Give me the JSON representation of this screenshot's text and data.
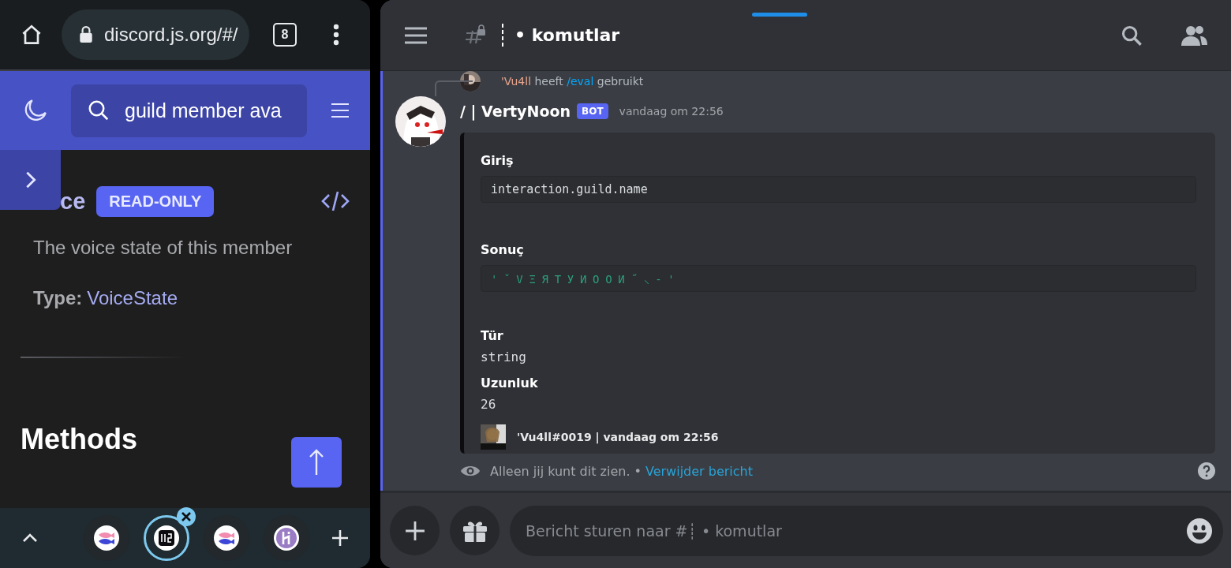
{
  "browser": {
    "url": "discord.js.org/#/",
    "tab_count": "8"
  },
  "docs": {
    "search_value": "guild member ava",
    "property_name": "ce",
    "badge": "READ-ONLY",
    "description": "The voice state of this member",
    "type_label": "Type:",
    "type_value": "VoiceState",
    "section": "Methods"
  },
  "tab_strip": {
    "tabs": [
      {
        "kind": "fish",
        "selected": false
      },
      {
        "kind": "djs",
        "selected": true
      },
      {
        "kind": "fish",
        "selected": false
      },
      {
        "kind": "heroku",
        "selected": false
      }
    ]
  },
  "channel": {
    "name": "• komutlar"
  },
  "message": {
    "reply": {
      "user": "'Vu4ll",
      "verb": "heeft",
      "command": "/eval",
      "suffix": "gebruikt"
    },
    "author": "/ | VertyNoon",
    "tag": "BOT",
    "time": "vandaag om 22:56",
    "fields": [
      {
        "name": "Giriş",
        "value": "interaction.guild.name",
        "kind": "code"
      },
      {
        "name": "Sonuç",
        "value": "'ˇVΞЯTУИOOИ˝⸜-'",
        "kind": "result"
      },
      {
        "name": "Tür",
        "value": "string",
        "kind": "inline"
      },
      {
        "name": "Uzunluk",
        "value": "26",
        "kind": "inline"
      }
    ],
    "footer": "'Vu4ll#0019 | vandaag om 22:56",
    "note": "Alleen jij kunt dit zien. •",
    "note_link": "Verwijder bericht"
  },
  "composer": {
    "placeholder": "Bericht sturen naar #┊ • komutlar"
  }
}
